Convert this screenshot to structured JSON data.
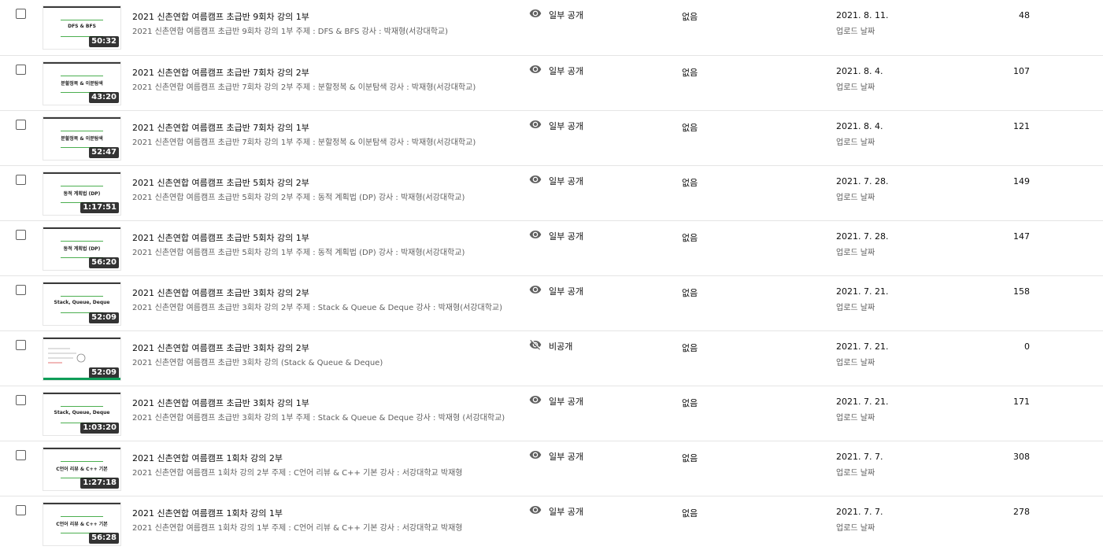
{
  "labels": {
    "upload_date_sub": "업로드 날짜",
    "restrictions_none": "없음"
  },
  "icons": {
    "unlisted": "eye-icon",
    "private": "eye-off-icon"
  },
  "rows": [
    {
      "thumb_title": "DFS & BFS",
      "duration": "50:32",
      "title": "2021 신촌연합 여름캠프 초급반 9회차 강의 1부",
      "description": "2021 신촌연합 여름캠프 초급반 9회차 강의 1부 주제 : DFS & BFS 강사 : 박재형(서강대학교)",
      "visibility": "일부 공개",
      "visibility_type": "unlisted",
      "restrictions": "없음",
      "date": "2021. 8. 11.",
      "views": "48"
    },
    {
      "thumb_title": "분할정복 & 이분탐색",
      "duration": "43:20",
      "title": "2021 신촌연합 여름캠프 초급반 7회차 강의 2부",
      "description": "2021 신촌연합 여름캠프 초급반 7회차 강의 2부 주제 : 분할정복 & 이분탐색 강사 : 박재형(서강대학교)",
      "visibility": "일부 공개",
      "visibility_type": "unlisted",
      "restrictions": "없음",
      "date": "2021. 8. 4.",
      "views": "107"
    },
    {
      "thumb_title": "분할정복 & 이분탐색",
      "duration": "52:47",
      "title": "2021 신촌연합 여름캠프 초급반 7회차 강의 1부",
      "description": "2021 신촌연합 여름캠프 초급반 7회차 강의 1부 주제 : 분할정복 & 이분탐색 강사 : 박재형(서강대학교)",
      "visibility": "일부 공개",
      "visibility_type": "unlisted",
      "restrictions": "없음",
      "date": "2021. 8. 4.",
      "views": "121"
    },
    {
      "thumb_title": "동적 계획법 (DP)",
      "duration": "1:17:51",
      "title": "2021 신촌연합 여름캠프 초급반 5회차 강의 2부",
      "description": "2021 신촌연합 여름캠프 초급반 5회차 강의 2부 주제 : 동적 계획법 (DP) 강사 : 박재형(서강대학교)",
      "visibility": "일부 공개",
      "visibility_type": "unlisted",
      "restrictions": "없음",
      "date": "2021. 7. 28.",
      "views": "149"
    },
    {
      "thumb_title": "동적 계획법 (DP)",
      "duration": "56:20",
      "title": "2021 신촌연합 여름캠프 초급반 5회차 강의 1부",
      "description": "2021 신촌연합 여름캠프 초급반 5회차 강의 1부 주제 : 동적 계획법 (DP) 강사 : 박재형(서강대학교)",
      "visibility": "일부 공개",
      "visibility_type": "unlisted",
      "restrictions": "없음",
      "date": "2021. 7. 28.",
      "views": "147"
    },
    {
      "thumb_title": "Stack, Queue, Deque",
      "duration": "52:09",
      "title": "2021 신촌연합 여름캠프 초급반 3회차 강의 2부",
      "description": "2021 신촌연합 여름캠프 초급반 3회차 강의 2부 주제 : Stack & Queue & Deque 강사 : 박재형(서강대학교)",
      "visibility": "일부 공개",
      "visibility_type": "unlisted",
      "restrictions": "없음",
      "date": "2021. 7. 21.",
      "views": "158"
    },
    {
      "thumb_title": "",
      "duration": "52:09",
      "title": "2021 신촌연합 여름캠프 초급반 3회차 강의 2부",
      "description": "2021 신촌연합 여름캠프 초급반 3회차 강의 (Stack & Queue & Deque)",
      "visibility": "비공개",
      "visibility_type": "private",
      "restrictions": "없음",
      "date": "2021. 7. 21.",
      "views": "0"
    },
    {
      "thumb_title": "Stack, Queue, Deque",
      "duration": "1:03:20",
      "title": "2021 신촌연합 여름캠프 초급반 3회차 강의 1부",
      "description": "2021 신촌연합 여름캠프 초급반 3회차 강의 1부 주제 : Stack & Queue & Deque 강사 : 박재형 (서강대학교)",
      "visibility": "일부 공개",
      "visibility_type": "unlisted",
      "restrictions": "없음",
      "date": "2021. 7. 21.",
      "views": "171"
    },
    {
      "thumb_title": "C언어 리뷰 & C++ 기본",
      "duration": "1:27:18",
      "title": "2021 신촌연합 여름캠프 1회차 강의 2부",
      "description": "2021 신촌연합 여름캠프 1회차 강의 2부 주제 : C언어 리뷰 & C++ 기본 강사 : 서강대학교 박재형",
      "visibility": "일부 공개",
      "visibility_type": "unlisted",
      "restrictions": "없음",
      "date": "2021. 7. 7.",
      "views": "308"
    },
    {
      "thumb_title": "C언어 리뷰 & C++ 기본",
      "duration": "56:28",
      "title": "2021 신촌연합 여름캠프 1회차 강의 1부",
      "description": "2021 신촌연합 여름캠프 1회차 강의 1부 주제 : C언어 리뷰 & C++ 기본 강사 : 서강대학교 박재형",
      "visibility": "일부 공개",
      "visibility_type": "unlisted",
      "restrictions": "없음",
      "date": "2021. 7. 7.",
      "views": "278"
    }
  ]
}
